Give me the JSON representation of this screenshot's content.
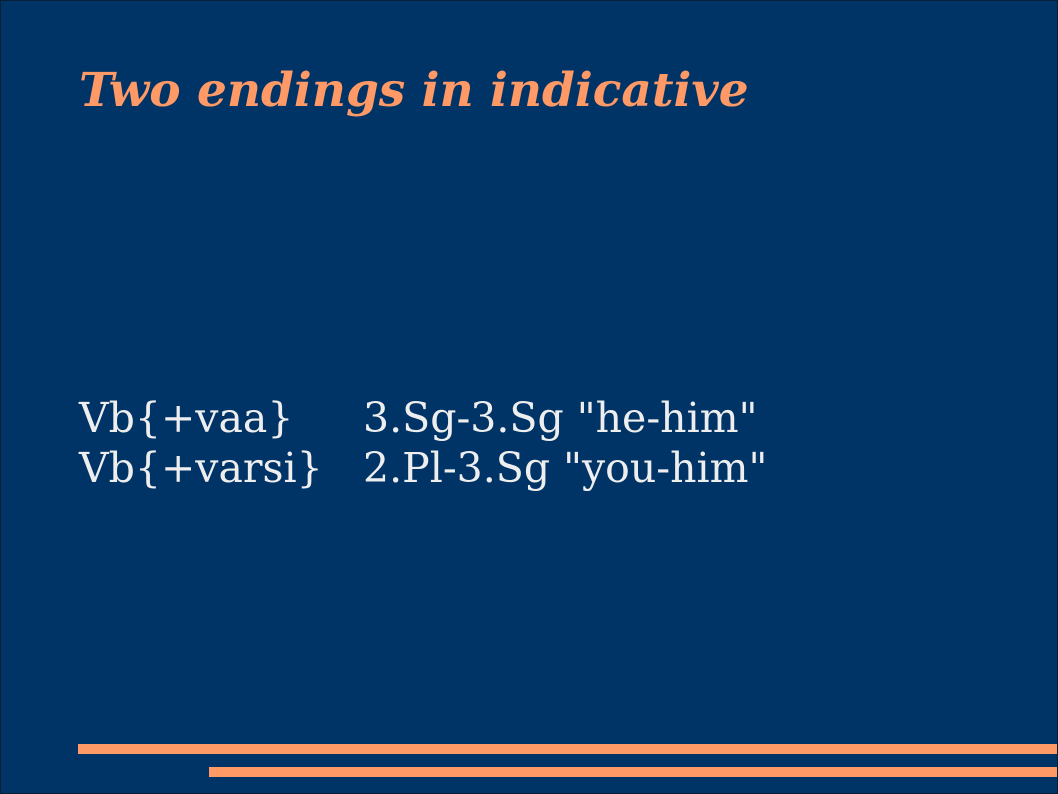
{
  "slide": {
    "title": "Two endings in indicative",
    "rows": [
      {
        "form": "Vb{+vaa}",
        "gloss": "3.Sg-3.Sg \"he-him\""
      },
      {
        "form": "Vb{+varsi}",
        "gloss": "2.Pl-3.Sg \"you-him\""
      }
    ]
  },
  "colors": {
    "background": "#003366",
    "accent": "#ff9966",
    "text": "#eeeeee"
  }
}
